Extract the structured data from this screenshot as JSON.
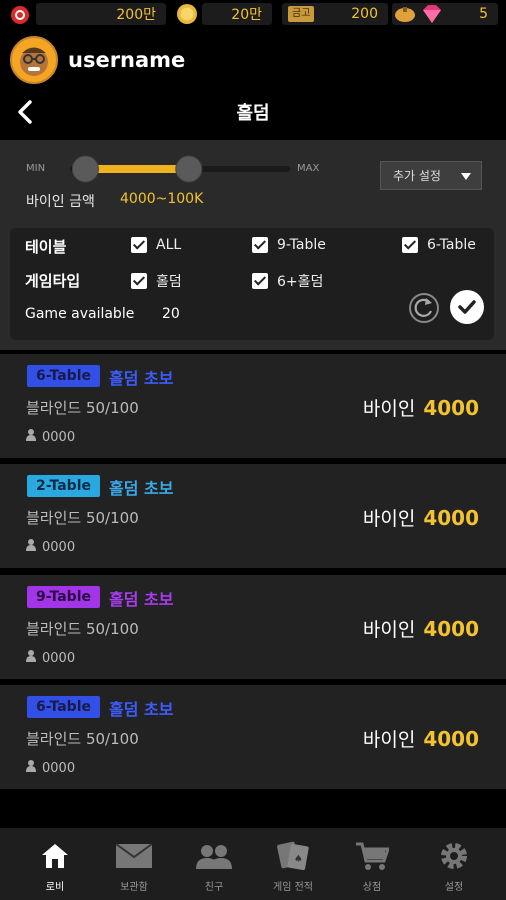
{
  "currency": {
    "chips": "200만",
    "gold": "20만",
    "ticket_label": "금고",
    "ticket": "200",
    "gift_count": "5"
  },
  "profile": {
    "username": "username"
  },
  "header": {
    "title": "홀덤"
  },
  "filter": {
    "slider_min": "MIN",
    "slider_max": "MAX",
    "slider_low_fraction": 0.07,
    "slider_high_fraction": 0.54,
    "buyin_label": "바이인 금액",
    "buyin_range": "4000~100K",
    "more_settings": "추가 설정",
    "table_label": "테이블",
    "gametype_label": "게임타입",
    "options": {
      "all": "ALL",
      "nine_table": "9-Table",
      "six_table": "6-Table",
      "holdem": "홀덤",
      "six_plus_holdem": "6+홀덤"
    },
    "available_label": "Game available",
    "available_count": "20"
  },
  "games": [
    {
      "tag": "6-Table",
      "tag_color": "#3250e6",
      "tag_text_color": "#1a1a4a",
      "name": "홀덤 초보",
      "name_color": "#3c5cff",
      "blind": "블라인드 50/100",
      "players": "0000",
      "buyin_label": "바이인",
      "buyin": "4000"
    },
    {
      "tag": "2-Table",
      "tag_color": "#2aa8e0",
      "tag_text_color": "#0b2a44",
      "name": "홀덤 초보",
      "name_color": "#3aa9e8",
      "blind": "블라인드 50/100",
      "players": "0000",
      "buyin_label": "바이인",
      "buyin": "4000"
    },
    {
      "tag": "9-Table",
      "tag_color": "#a235e8",
      "tag_text_color": "#2a0b44",
      "name": "홀덤 초보",
      "name_color": "#a73cf0",
      "blind": "블라인드 50/100",
      "players": "0000",
      "buyin_label": "바이인",
      "buyin": "4000"
    },
    {
      "tag": "6-Table",
      "tag_color": "#3250e6",
      "tag_text_color": "#1a1a4a",
      "name": "홀덤 초보",
      "name_color": "#3c5cff",
      "blind": "블라인드 50/100",
      "players": "0000",
      "buyin_label": "바이인",
      "buyin": "4000"
    }
  ],
  "nav": {
    "lobby": "로비",
    "mailbox": "보관함",
    "friends": "친구",
    "record": "게임 전적",
    "shop": "상점",
    "settings": "설정"
  },
  "colors": {
    "accent": "#f2c230",
    "panel": "#2a2a2a",
    "card": "#222222"
  }
}
